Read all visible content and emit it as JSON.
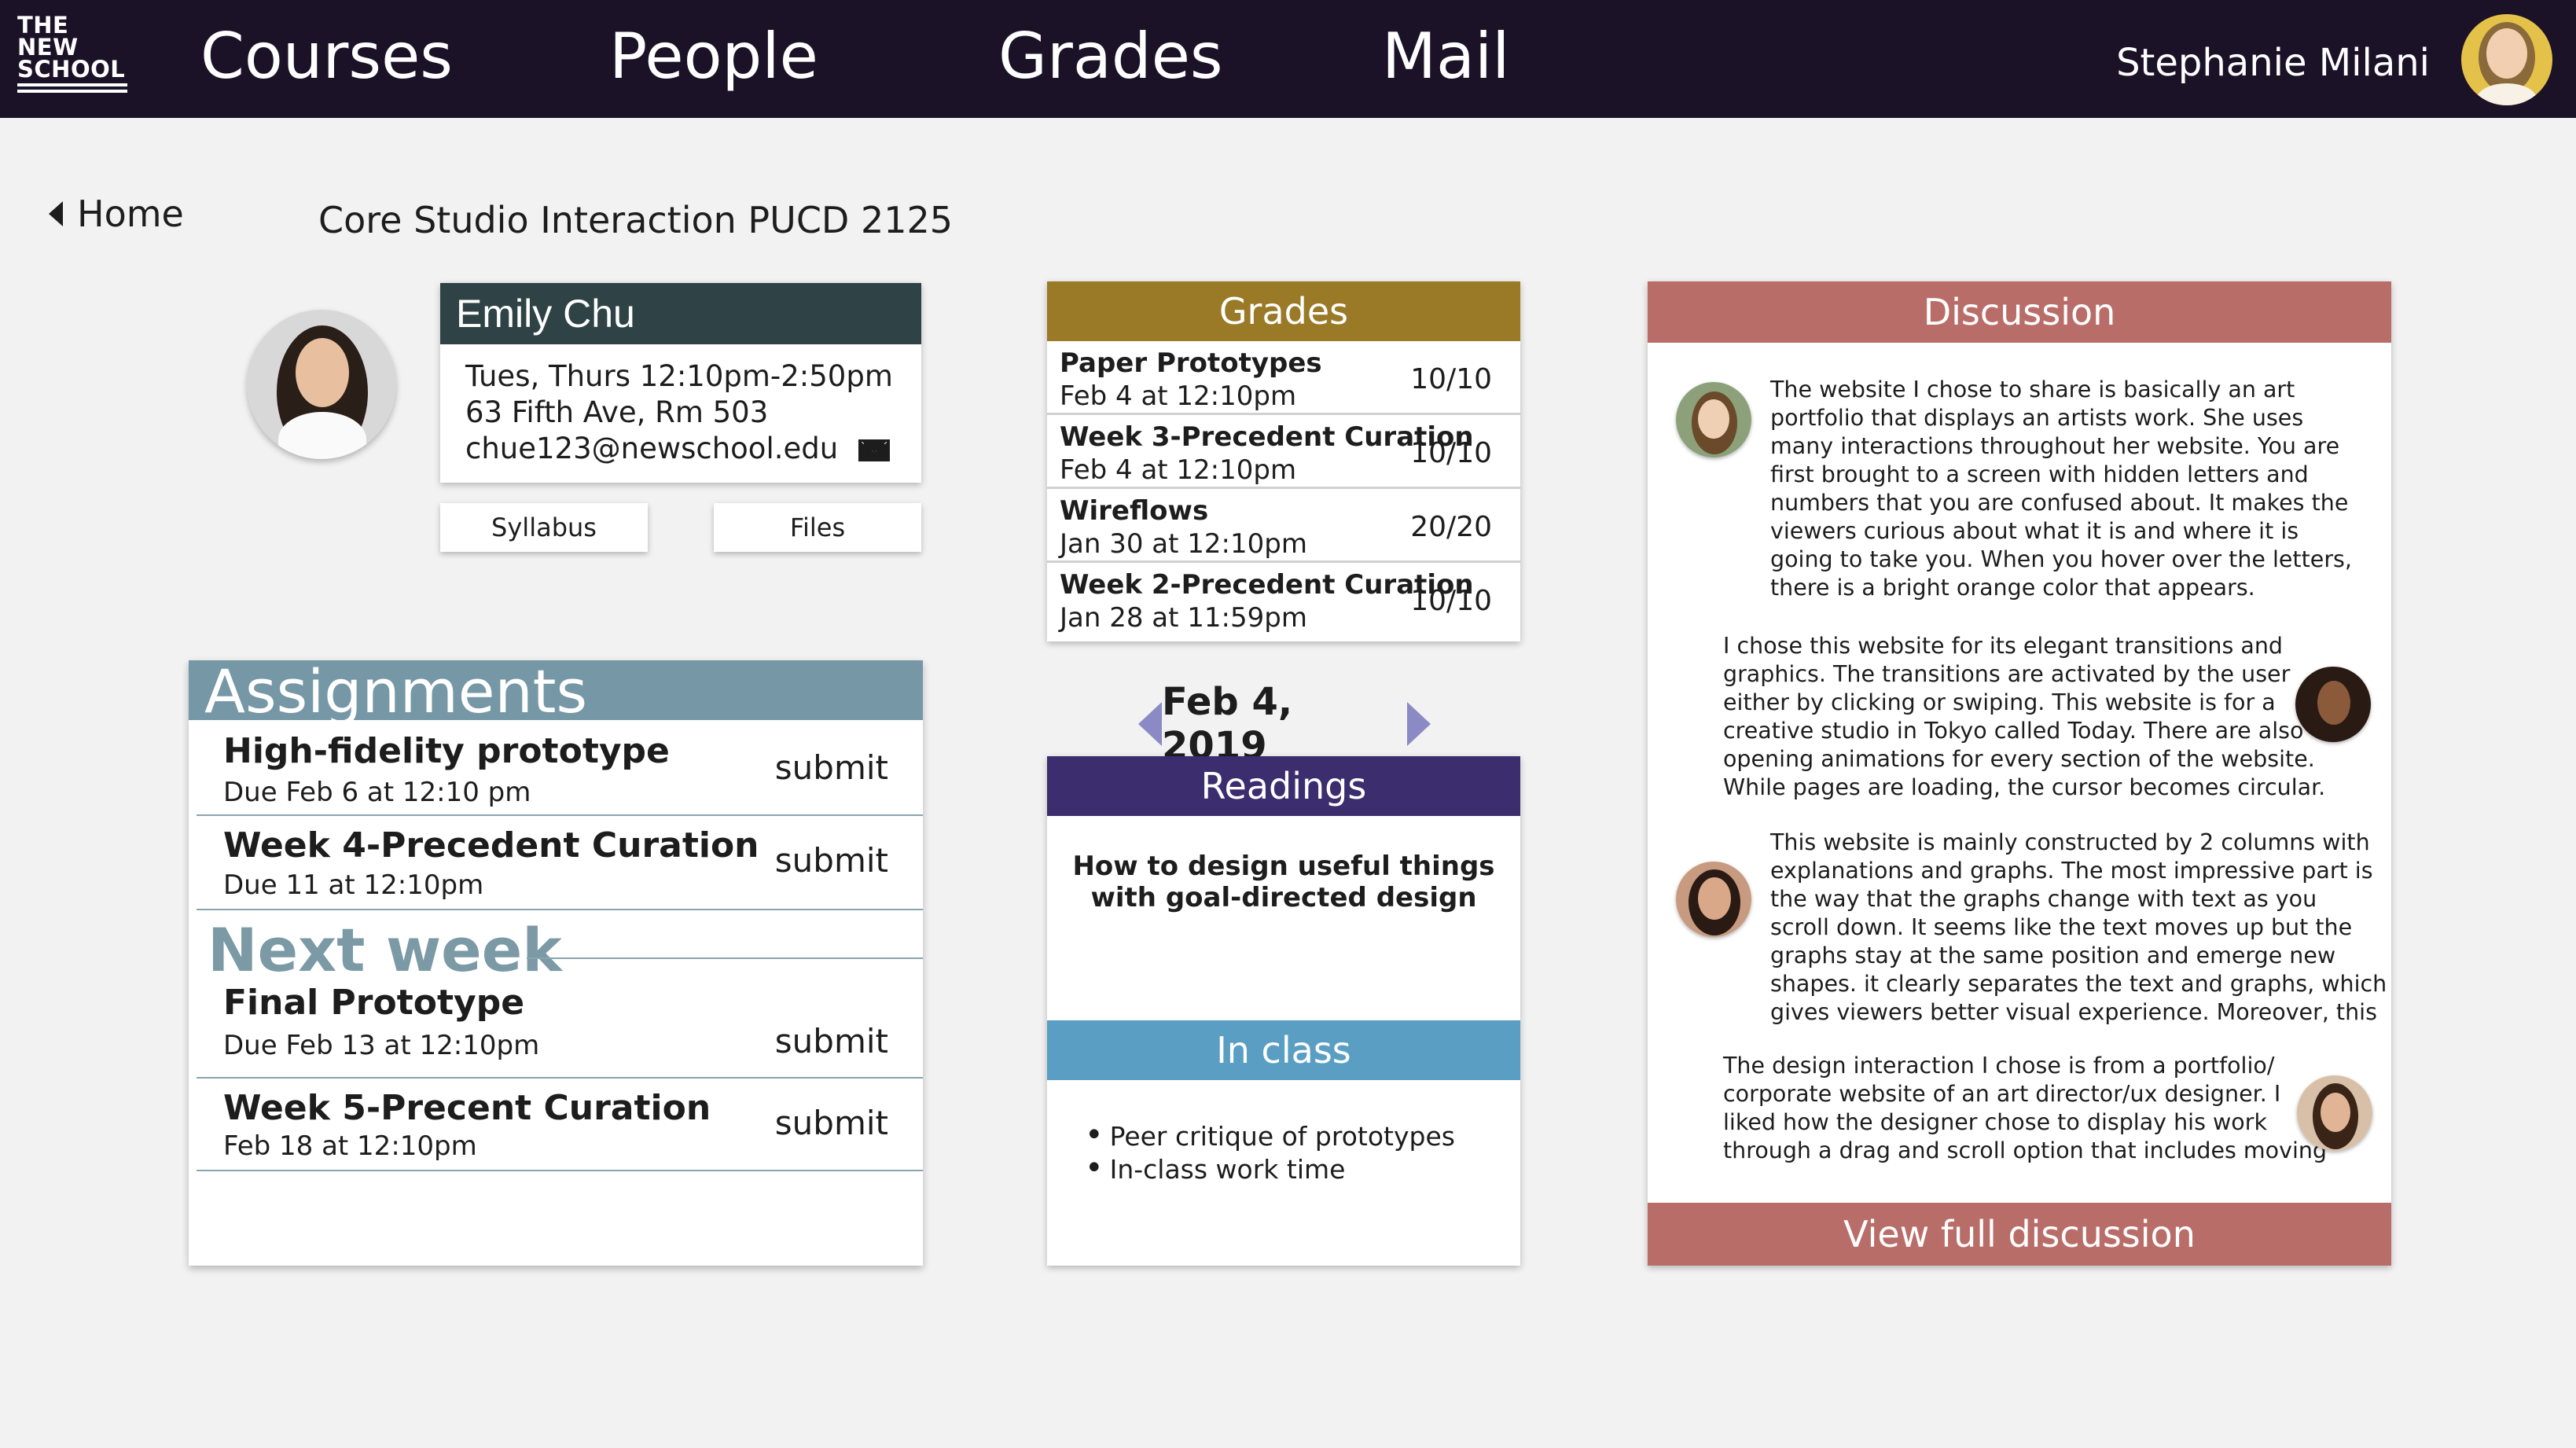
{
  "nav": {
    "logo_lines": [
      "THE",
      "NEW",
      "SCHOOL"
    ],
    "links": [
      "Courses",
      "People",
      "Grades",
      "Mail"
    ],
    "user_name": "Stephanie Milani"
  },
  "header": {
    "home_label": "Home",
    "course_title": "Core Studio Interaction PUCD 2125"
  },
  "instructor": {
    "name": "Emily Chu",
    "schedule": "Tues, Thurs 12:10pm-2:50pm",
    "location": "63 Fifth Ave, Rm 503",
    "email": "chue123@newschool.edu",
    "buttons": [
      "Syllabus",
      "Files"
    ]
  },
  "assignments": {
    "title": "Assignments",
    "current": [
      {
        "title": "High-fidelity prototype",
        "due": "Due Feb 6 at 12:10 pm",
        "action": "submit"
      },
      {
        "title": "Week 4-Precedent Curation",
        "due": "Due 11 at 12:10pm",
        "action": "submit"
      }
    ],
    "next_week_label": "Next week",
    "next": [
      {
        "title": "Final Prototype",
        "due": "Due Feb 13 at 12:10pm",
        "action": "submit"
      },
      {
        "title": "Week 5-Precent Curation",
        "due": "Feb 18 at 12:10pm",
        "action": "submit"
      }
    ]
  },
  "grades": {
    "title": "Grades",
    "items": [
      {
        "name": "Paper Prototypes",
        "date": "Feb 4 at 12:10pm",
        "score": "10/10"
      },
      {
        "name": "Week 3-Precedent Curation",
        "date": "Feb 4 at 12:10pm",
        "score": "10/10"
      },
      {
        "name": "Wireflows",
        "date": "Jan 30 at 12:10pm",
        "score": "20/20"
      },
      {
        "name": "Week 2-Precedent Curation",
        "date": "Jan 28 at 11:59pm",
        "score": "10/10"
      }
    ]
  },
  "day": {
    "date": "Feb 4, 2019",
    "readings_title": "Readings",
    "reading_line1": "How to design useful things",
    "reading_line2": "with goal-directed design",
    "inclass_title": "In class",
    "inclass_items": [
      "Peer critique of prototypes",
      "In-class work time"
    ]
  },
  "discussion": {
    "title": "Discussion",
    "posts": [
      [
        "The website I chose to share is basically an art",
        "portfolio that displays an artists work. She uses",
        "many interactions throughout her website. You are",
        "first brought to a screen with hidden letters and",
        "numbers that you are confused about. It makes the",
        "viewers curious about what it is and where it is",
        "going to take you. When you hover over the letters,",
        "there is a bright orange color that appears."
      ],
      [
        "I chose this website for its elegant transitions and",
        "graphics. The transitions are activated by the user",
        "either by clicking or swiping. This website is for a",
        "creative studio in Tokyo called Today. There are also",
        "opening animations for every section of the website.",
        "While pages are loading, the cursor becomes circular."
      ],
      [
        "This website is mainly constructed by 2 columns with",
        "explanations and graphs. The most impressive part is",
        "the way that the graphs change with text as you",
        "scroll down. It seems like the text moves up but the",
        "graphs stay at the same position and emerge new",
        "shapes. it clearly separates the text and graphs, which",
        "gives viewers better visual experience. Moreover, this"
      ],
      [
        "The design interaction I chose is from a portfolio/",
        "corporate website of an art director/ux designer. I",
        "liked how the designer chose to display his work",
        "through a drag and scroll option that includes moving"
      ]
    ],
    "view_full": "View full discussion"
  }
}
